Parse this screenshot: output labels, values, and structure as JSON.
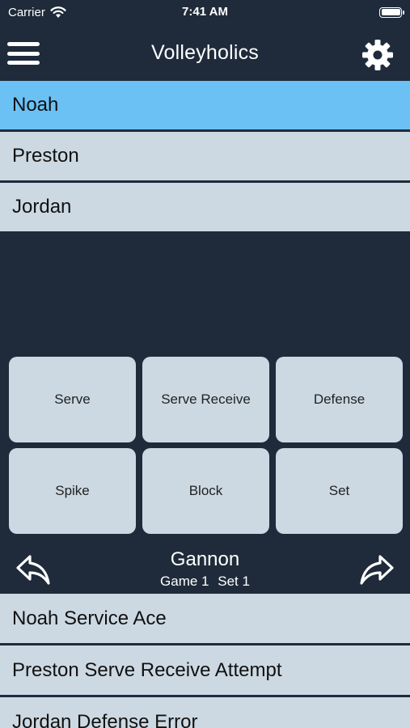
{
  "status_bar": {
    "carrier": "Carrier",
    "time": "7:41 AM"
  },
  "nav": {
    "title": "Volleyholics"
  },
  "players": [
    {
      "name": "Noah",
      "selected": true
    },
    {
      "name": "Preston",
      "selected": false
    },
    {
      "name": "Jordan",
      "selected": false
    }
  ],
  "actions": [
    "Serve",
    "Serve Receive",
    "Defense",
    "Spike",
    "Block",
    "Set"
  ],
  "footer": {
    "current_player": "Gannon",
    "game_label": "Game 1",
    "set_label": "Set 1"
  },
  "log": [
    "Noah Service Ace",
    "Preston Serve Receive Attempt",
    "Jordan Defense Error"
  ],
  "colors": {
    "background": "#1f2b3b",
    "row": "#ccd9e3",
    "selected_row": "#6bc1f4"
  }
}
